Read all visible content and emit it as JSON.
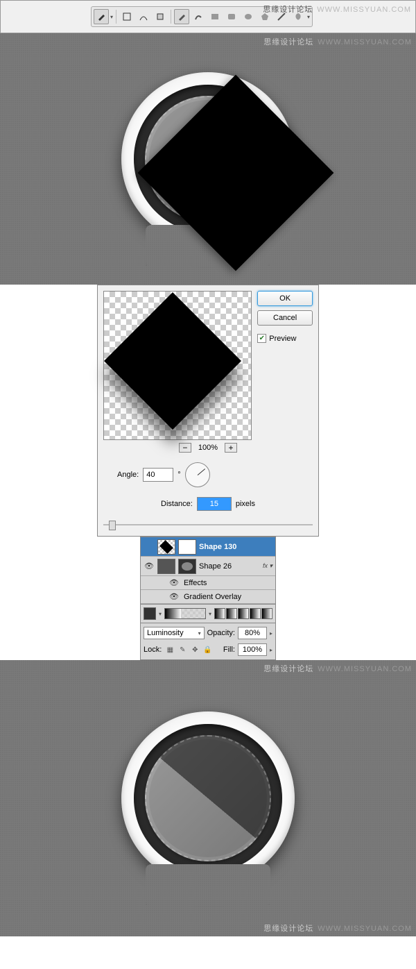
{
  "watermark": {
    "cn": "思缘设计论坛",
    "en": "WWW.MISSYUAN.COM"
  },
  "toolbar": {
    "tools": [
      "pen",
      "rect-select",
      "transform",
      "marquee",
      "pen2",
      "brush",
      "rect-shape",
      "rounded-rect",
      "ellipse",
      "hexagon",
      "line",
      "custom-shape"
    ]
  },
  "dialog": {
    "ok": "OK",
    "cancel": "Cancel",
    "preview_label": "Preview",
    "preview_checked": true,
    "zoom": "100%",
    "angle_label": "Angle:",
    "angle_value": "40",
    "degree": "°",
    "distance_label": "Distance:",
    "distance_value": "15",
    "distance_unit": "pixels"
  },
  "layers": {
    "items": [
      {
        "name": "Shape 130",
        "selected": true
      },
      {
        "name": "Shape 26",
        "selected": false,
        "fx": true
      }
    ],
    "effects_label": "Effects",
    "gradient_overlay": "Gradient Overlay"
  },
  "blend": {
    "mode": "Luminosity",
    "opacity_label": "Opacity:",
    "opacity_value": "80%",
    "lock_label": "Lock:",
    "fill_label": "Fill:",
    "fill_value": "100%"
  }
}
